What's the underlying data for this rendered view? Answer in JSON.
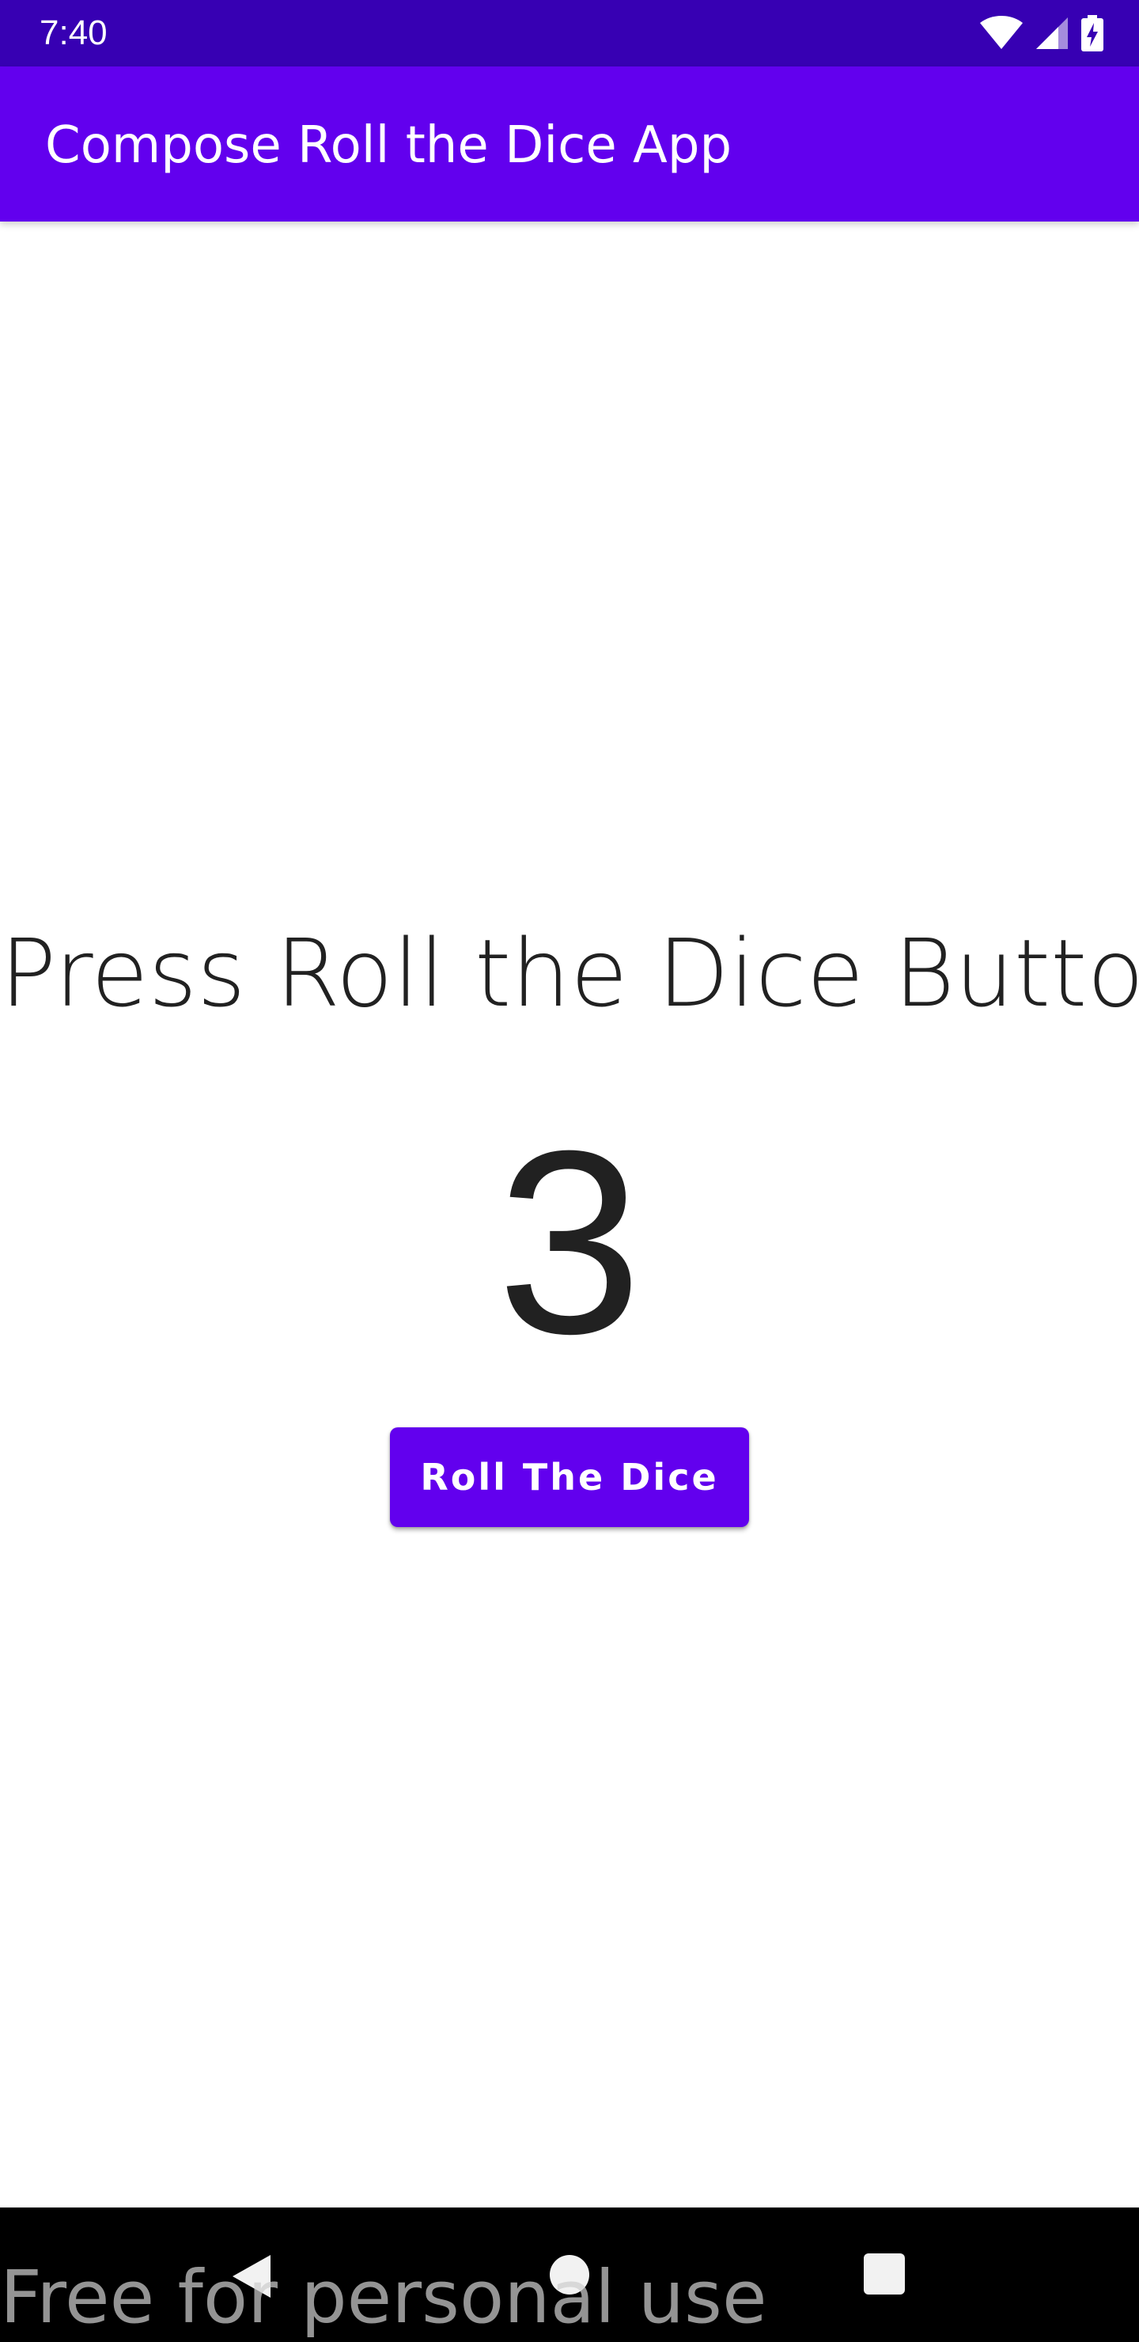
{
  "status_bar": {
    "time": "7:40",
    "icons": [
      "wifi-icon",
      "signal-icon",
      "battery-charging-icon"
    ]
  },
  "app_bar": {
    "title": "Compose Roll the Dice App"
  },
  "main": {
    "prompt": "Press Roll the Dice Button",
    "dice_value": "3",
    "roll_button_label": "Roll The Dice"
  },
  "nav_bar": {
    "items": [
      "back-icon",
      "home-icon",
      "recents-icon"
    ]
  },
  "watermark": "Free for personal use",
  "colors": {
    "status_bar": "#3700b3",
    "primary": "#6200ee",
    "text": "#212121",
    "background": "#ffffff",
    "nav_bar": "#000000"
  }
}
